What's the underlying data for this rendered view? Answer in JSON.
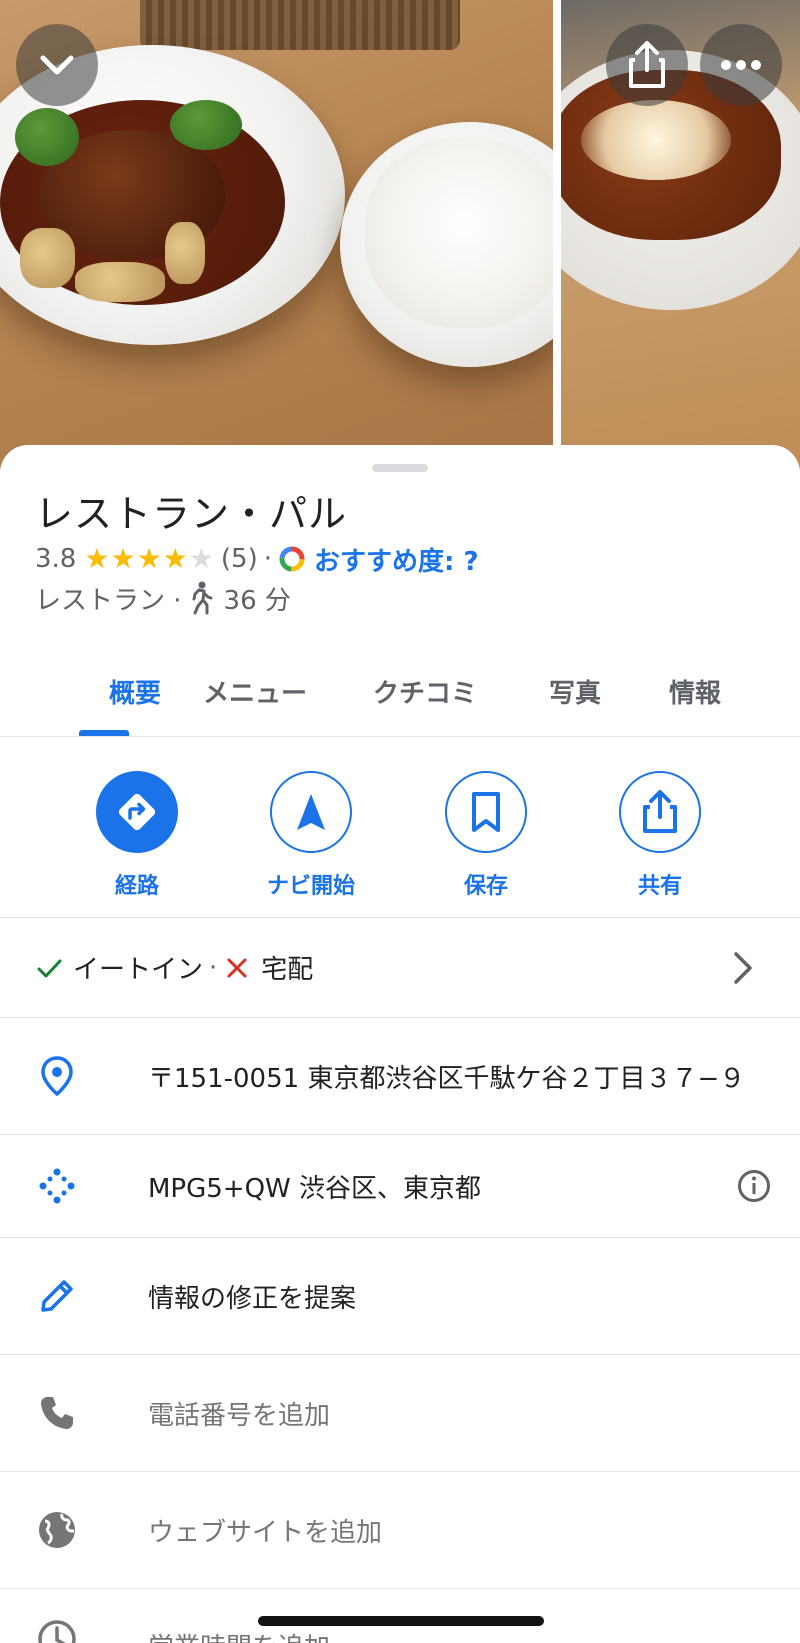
{
  "place": {
    "name": "レストラン・パル",
    "rating": "3.8",
    "review_count": "(5)",
    "stars_filled": 4,
    "separator": "·",
    "recommend_label": "おすすめ度: ?",
    "category": "レストラン ·",
    "walk_time": "36 分"
  },
  "tabs": [
    {
      "label": "概要",
      "active": true
    },
    {
      "label": "メニュー",
      "active": false
    },
    {
      "label": "クチコミ",
      "active": false
    },
    {
      "label": "写真",
      "active": false
    },
    {
      "label": "情報",
      "active": false
    }
  ],
  "actions": [
    {
      "label": "経路",
      "icon": "directions-icon"
    },
    {
      "label": "ナビ開始",
      "icon": "navigation-arrow-icon"
    },
    {
      "label": "保存",
      "icon": "bookmark-icon"
    },
    {
      "label": "共有",
      "icon": "share-icon"
    }
  ],
  "service": {
    "dine_in": "イートイン",
    "separator": "·",
    "delivery": "宅配",
    "dine_in_available": true,
    "delivery_available": false
  },
  "details": {
    "address": "〒151-0051 東京都渋谷区千駄ケ谷２丁目３７−９",
    "plus_code": "MPG5+QW 渋谷区、東京都",
    "suggest_edit": "情報の修正を提案",
    "add_phone": "電話番号を追加",
    "add_website": "ウェブサイトを追加",
    "add_hours": "営業時間を追加"
  },
  "colors": {
    "accent": "#1a73e8",
    "star": "#fbbc04",
    "check": "#188038",
    "cross": "#d93025"
  }
}
